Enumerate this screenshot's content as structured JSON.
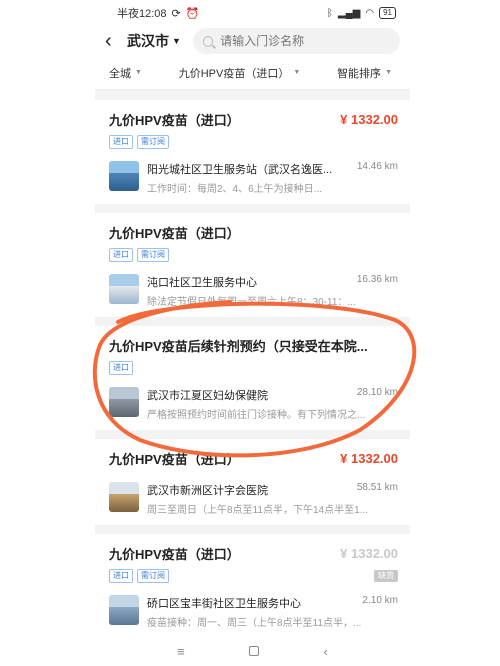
{
  "status_bar": {
    "time": "半夜12:08",
    "battery": "91",
    "icons": [
      "sync-icon",
      "alarm-icon",
      "bluetooth-icon",
      "signal-icon",
      "wifi-icon"
    ]
  },
  "header": {
    "city": "武汉市",
    "search_placeholder": "请输入门诊名称"
  },
  "filters": [
    {
      "label": "全城"
    },
    {
      "label": "九价HPV疫苗（进口）"
    },
    {
      "label": "智能排序"
    }
  ],
  "cards": [
    {
      "title": "九价HPV疫苗（进口）",
      "price": "¥ 1332.00",
      "tags": [
        "进口",
        "需订阅"
      ],
      "badge": "",
      "clinic_name": "阳光城社区卫生服务站（武汉名逸医...",
      "distance": "14.46 km",
      "description": "工作时间：每周2、4、6上午为接种日..."
    },
    {
      "title": "九价HPV疫苗（进口）",
      "price": "",
      "tags": [
        "进口",
        "需订阅"
      ],
      "badge": "",
      "clinic_name": "沌口社区卫生服务中心",
      "distance": "16.36 km",
      "description": "除法定节假日外每周一至周六上午8：30-11：..."
    },
    {
      "title": "九价HPV疫苗后续针剂预约（只接受在本院...",
      "price": "",
      "tags": [
        "进口"
      ],
      "badge": "",
      "clinic_name": "武汉市江夏区妇幼保健院",
      "distance": "28.10 km",
      "description": "严格按照预约时间前往门诊接种。有下列情况之..."
    },
    {
      "title": "九价HPV疫苗（进口）",
      "price": "¥ 1332.00",
      "tags": [],
      "badge": "",
      "clinic_name": "武汉市新洲区计字会医院",
      "distance": "58.51 km",
      "description": "周三至周日（上午8点至11点半，下午14点半至1..."
    },
    {
      "title": "九价HPV疫苗（进口）",
      "price": "¥ 1332.00",
      "tags": [
        "进口",
        "需订阅"
      ],
      "badge": "缺货",
      "clinic_name": "硚口区宝丰街社区卫生服务中心",
      "distance": "2.10 km",
      "description": "疫苗接种：周一、周三（上午8点半至11点半，..."
    }
  ],
  "colors": {
    "price": "#e8472b",
    "annotation_circle": "#f26a3c",
    "tag_blue": "#3b7fd9"
  },
  "navbar": [
    "menu-icon",
    "home-square-icon",
    "back-chevron-icon"
  ]
}
